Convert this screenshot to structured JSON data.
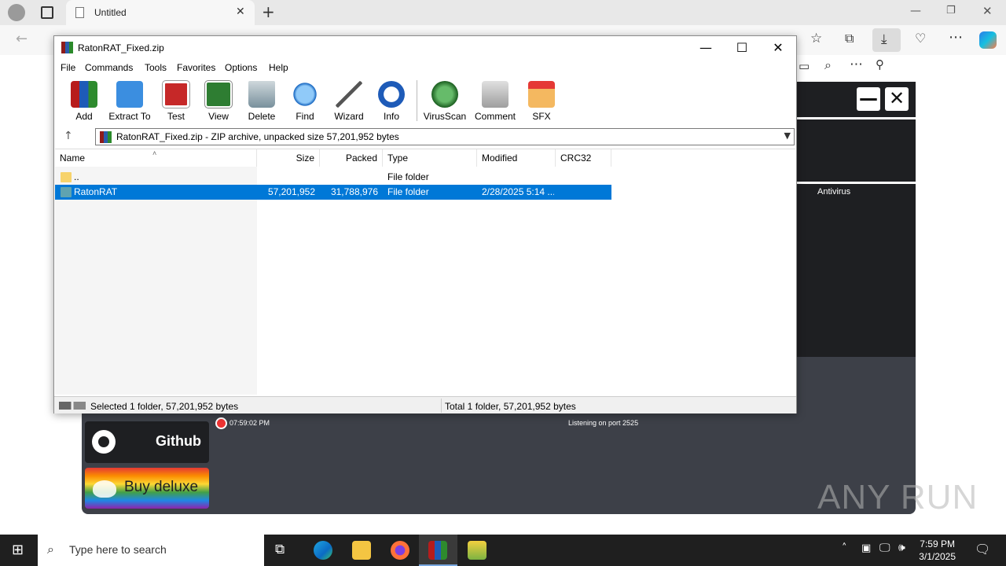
{
  "browser": {
    "tab_title": "Untitled"
  },
  "raton": {
    "antivirus_label": "Antivirus",
    "clock_text": "07:59:02 PM",
    "listening_text": "Listening on port 2525",
    "github_label": "Github",
    "deluxe_label": "Buy deluxe"
  },
  "winrar": {
    "title": "RatonRAT_Fixed.zip",
    "menu": [
      "File",
      "Commands",
      "Tools",
      "Favorites",
      "Options",
      "Help"
    ],
    "toolbar": [
      {
        "label": "Add",
        "icon": "add-archive-icon"
      },
      {
        "label": "Extract To",
        "icon": "extract-folder-icon"
      },
      {
        "label": "Test",
        "icon": "test-clipboard-icon"
      },
      {
        "label": "View",
        "icon": "view-book-icon"
      },
      {
        "label": "Delete",
        "icon": "trash-icon"
      },
      {
        "label": "Find",
        "icon": "magnifier-icon"
      },
      {
        "label": "Wizard",
        "icon": "wand-icon"
      },
      {
        "label": "Info",
        "icon": "info-icon"
      },
      {
        "label": "VirusScan",
        "icon": "bug-scan-icon"
      },
      {
        "label": "Comment",
        "icon": "comment-icon"
      },
      {
        "label": "SFX",
        "icon": "sfx-box-icon"
      }
    ],
    "address": "RatonRAT_Fixed.zip - ZIP archive, unpacked size 57,201,952 bytes",
    "columns": [
      "Name",
      "Size",
      "Packed",
      "Type",
      "Modified",
      "CRC32"
    ],
    "rows": [
      {
        "name": "..",
        "size": "",
        "packed": "",
        "type": "File folder",
        "modified": "",
        "crc": ""
      },
      {
        "name": "RatonRAT",
        "size": "57,201,952",
        "packed": "31,788,976",
        "type": "File folder",
        "modified": "2/28/2025 5:14 ...",
        "crc": ""
      }
    ],
    "status_left": "Selected 1 folder, 57,201,952 bytes",
    "status_right": "Total 1 folder, 57,201,952 bytes"
  },
  "taskbar": {
    "search_placeholder": "Type here to search",
    "time": "7:59 PM",
    "date": "3/1/2025"
  },
  "watermark": "ANY RUN"
}
